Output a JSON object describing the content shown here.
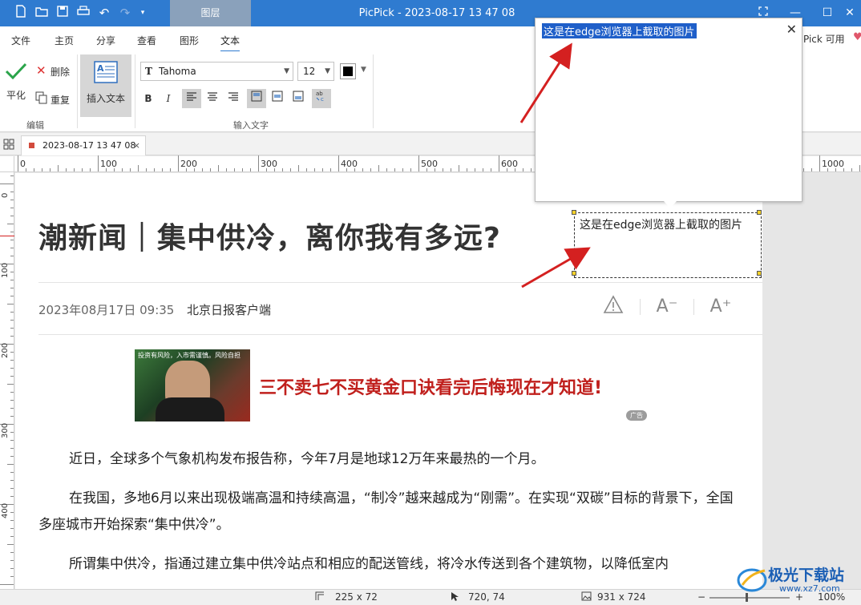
{
  "titlebar": {
    "context_tab": "图层",
    "title": "PicPick - 2023-08-17 13 47 08",
    "min": "—",
    "max": "☐",
    "close": "✕"
  },
  "ribbon_tabs": [
    "文件",
    "主页",
    "分享",
    "查看",
    "图形",
    "文本"
  ],
  "ribbon_partial": "Pick 可用",
  "ribbon": {
    "apply_label": "平化",
    "delete_label": "删除",
    "repeat_label": "重复",
    "edit_group": "编辑",
    "insert_text_label": "插入文本",
    "font_name": "Tahoma",
    "font_size": "12",
    "input_text_group": "输入文字",
    "bold": "B",
    "italic": "I"
  },
  "doc_tab": {
    "name": "2023-08-17 13 47 08",
    "close": "×"
  },
  "ruler_h_labels": [
    "0",
    "100",
    "200",
    "300",
    "400",
    "500",
    "600",
    "1000"
  ],
  "ruler_v_labels": [
    "0",
    "100",
    "200",
    "300",
    "400"
  ],
  "article": {
    "headline": "潮新闻｜集中供冷，离你我有多远?",
    "date": "2023年08月17日 09:35",
    "source": "北京日报客户端",
    "ad_caption": "投资有风险，入市需谨慎。风险自担",
    "ad_text": "三不卖七不买黄金口诀看完后悔现在才知道!",
    "ad_badge": "广告",
    "paragraphs": [
      "近日，全球多个气象机构发布报告称，今年7月是地球12万年来最热的一个月。",
      "在我国，多地6月以来出现极端高温和持续高温，“制冷”越来越成为“刚需”。在实现“双碳”目标的背景下，全国多座城市开始探索“集中供冷”。",
      "所谓集中供冷，指通过建立集中供冷站点和相应的配送管线，将冷水传送到各个建筑物，以降低室内"
    ]
  },
  "textbox_text": "这是在edge浏览器上截取的图片",
  "popup_text": "这是在edge浏览器上截取的图片",
  "popup_close": "✕",
  "status": {
    "selection_size": "225 x 72",
    "cursor_pos": "720, 74",
    "image_size": "931 x 724",
    "zoom": "100%"
  },
  "watermark": {
    "brand": "极光下载站",
    "url": "www.xz7.com"
  },
  "colors": {
    "accent": "#2f7bd0",
    "arrow": "#d42020",
    "ad_red": "#c0201d"
  }
}
